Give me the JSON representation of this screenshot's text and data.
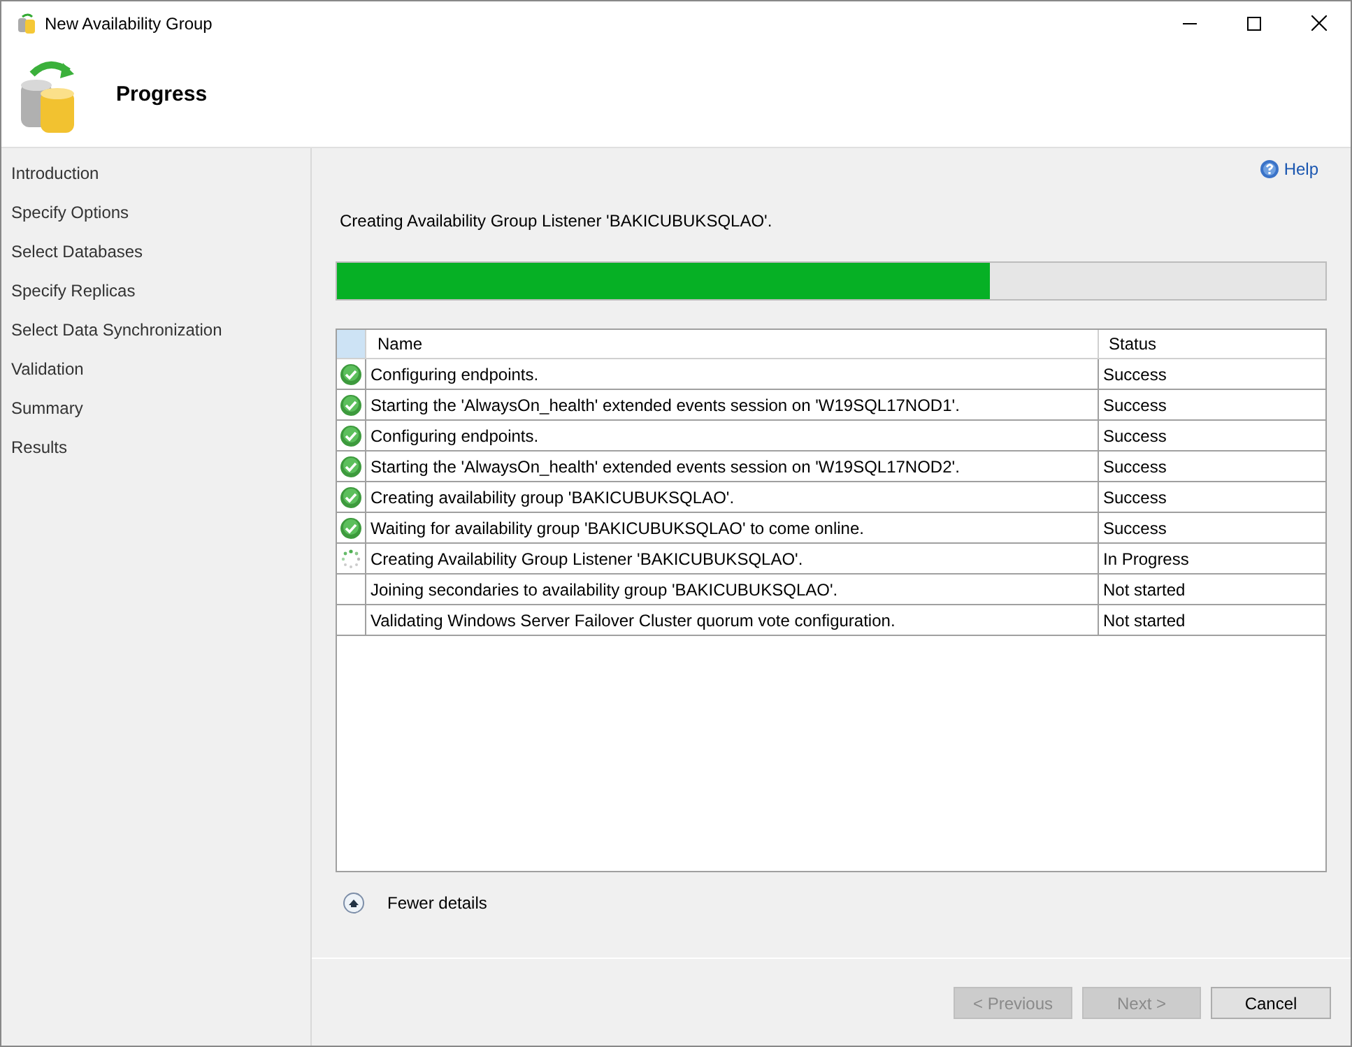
{
  "window": {
    "title": "New Availability Group"
  },
  "header": {
    "title": "Progress"
  },
  "sidebar": {
    "items": [
      "Introduction",
      "Specify Options",
      "Select Databases",
      "Specify Replicas",
      "Select Data Synchronization",
      "Validation",
      "Summary",
      "Results"
    ]
  },
  "help": "Help",
  "current_action": "Creating Availability Group Listener 'BAKICUBUKSQLAO'.",
  "progress": {
    "level": 0.66
  },
  "table": {
    "columns": [
      "Name",
      "Status"
    ],
    "rows": [
      {
        "kind": "success",
        "name": "Configuring endpoints.",
        "status": "Success"
      },
      {
        "kind": "success",
        "name": "Starting the 'AlwaysOn_health' extended events session on 'W19SQL17NOD1'.",
        "status": "Success"
      },
      {
        "kind": "success",
        "name": "Configuring endpoints.",
        "status": "Success"
      },
      {
        "kind": "success",
        "name": "Starting the 'AlwaysOn_health' extended events session on 'W19SQL17NOD2'.",
        "status": "Success"
      },
      {
        "kind": "success",
        "name": "Creating availability group 'BAKICUBUKSQLAO'.",
        "status": "Success"
      },
      {
        "kind": "success",
        "name": "Waiting for availability group 'BAKICUBUKSQLAO' to come online.",
        "status": "Success"
      },
      {
        "kind": "in_progress",
        "name": "Creating Availability Group Listener 'BAKICUBUKSQLAO'.",
        "status": "In Progress"
      },
      {
        "kind": "not_started",
        "name": "Joining secondaries to availability group 'BAKICUBUKSQLAO'.",
        "status": "Not started"
      },
      {
        "kind": "not_started",
        "name": "Validating Windows Server Failover Cluster quorum vote configuration.",
        "status": "Not started"
      }
    ]
  },
  "details_toggle": "Fewer details",
  "buttons": [
    {
      "label": "< Previous",
      "disabled": true
    },
    {
      "label": "Next >",
      "disabled": true
    },
    {
      "label": "Cancel",
      "disabled": false
    }
  ]
}
